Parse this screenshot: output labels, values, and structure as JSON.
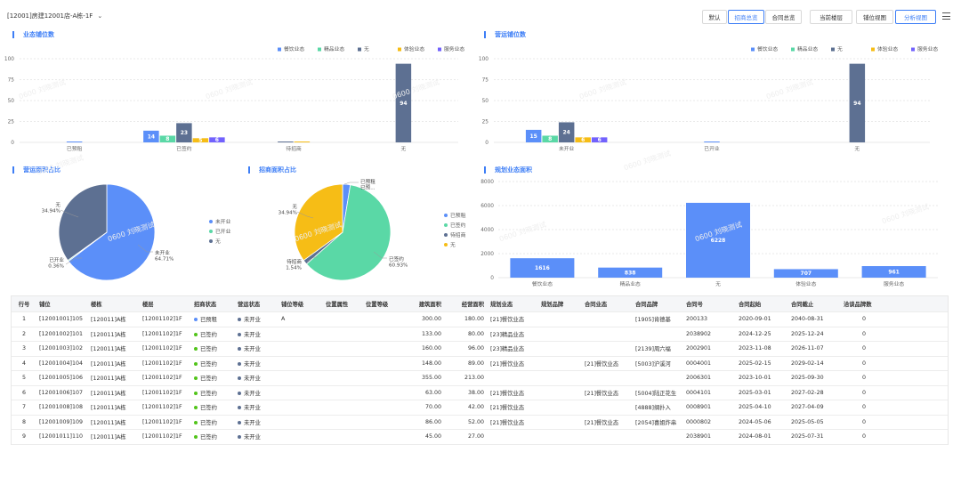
{
  "header": {
    "breadcrumb": "[12001]房建12001店-A栋-1F",
    "buttons": [
      "默认",
      "招商总览",
      "合同总览",
      "当前楼层",
      "铺位视图",
      "分析视图"
    ],
    "active_buttons": [
      1,
      5
    ]
  },
  "colors": {
    "accent": "#3d7ef6",
    "dining": "#5b8ff9",
    "boutique": "#5ad8a6",
    "none": "#5d7092",
    "experience": "#f6bd16",
    "service": "#7262fd"
  },
  "legend_biz": [
    "餐饮业态",
    "精品业态",
    "无",
    "体验业态",
    "服务业态"
  ],
  "watermark": "0600 刘晓测试",
  "panels": {
    "biz_slots": "业态铺位数",
    "op_slots": "营运铺位数",
    "op_area": "营运面积占比",
    "inv_area": "招商面积占比",
    "plan_area": "规划业态面积"
  },
  "chart_data": [
    {
      "type": "bar",
      "title": "业态铺位数",
      "categories": [
        "已预租",
        "已签约",
        "待招商",
        "无"
      ],
      "series": [
        {
          "name": "餐饮业态",
          "values": [
            1,
            14,
            0,
            0
          ]
        },
        {
          "name": "精品业态",
          "values": [
            0,
            8,
            0,
            0
          ]
        },
        {
          "name": "无",
          "values": [
            0,
            23,
            1,
            94
          ]
        },
        {
          "name": "体验业态",
          "values": [
            0,
            5,
            1,
            0
          ]
        },
        {
          "name": "服务业态",
          "values": [
            0,
            6,
            0,
            0
          ]
        }
      ],
      "data_labels": [
        "14",
        "8",
        "23",
        "5",
        "6",
        "94"
      ],
      "ylim": [
        0,
        100
      ],
      "yticks": [
        0,
        25,
        50,
        75,
        100
      ],
      "legend": "top-right"
    },
    {
      "type": "bar",
      "title": "营运铺位数",
      "categories": [
        "未开业",
        "已开业",
        "无"
      ],
      "series": [
        {
          "name": "餐饮业态",
          "values": [
            15,
            1,
            0
          ]
        },
        {
          "name": "精品业态",
          "values": [
            8,
            0,
            0
          ]
        },
        {
          "name": "无",
          "values": [
            24,
            0,
            94
          ]
        },
        {
          "name": "体验业态",
          "values": [
            6,
            0,
            0
          ]
        },
        {
          "name": "服务业态",
          "values": [
            6,
            0,
            0
          ]
        }
      ],
      "data_labels": [
        "15",
        "8",
        "24",
        "6",
        "6",
        "94"
      ],
      "ylim": [
        0,
        100
      ],
      "yticks": [
        0,
        25,
        50,
        75,
        100
      ],
      "legend": "top-right"
    },
    {
      "type": "pie",
      "title": "营运面积占比",
      "labels": [
        "未开业",
        "已开业",
        "无"
      ],
      "values": [
        64.71,
        0.36,
        34.94
      ],
      "pct_labels": [
        "64.71%",
        "0.36%",
        "34.94%"
      ],
      "colors": [
        "#5b8ff9",
        "#5ad8a6",
        "#5d7092"
      ]
    },
    {
      "type": "pie",
      "title": "招商面积占比",
      "labels": [
        "已预租",
        "已签约",
        "待招商",
        "无"
      ],
      "values": [
        2.6,
        60.93,
        1.54,
        34.94
      ],
      "pct_labels": [
        "已预...",
        "60.93%",
        "1.54%",
        "34.94%"
      ],
      "colors": [
        "#5b8ff9",
        "#5ad8a6",
        "#5d7092",
        "#f6bd16"
      ]
    },
    {
      "type": "bar",
      "title": "规划业态面积",
      "categories": [
        "餐饮业态",
        "精品业态",
        "无",
        "体验业态",
        "服务业态"
      ],
      "values": [
        1616,
        838,
        6228,
        707,
        961
      ],
      "ylim": [
        0,
        8000
      ],
      "yticks": [
        0,
        2000,
        4000,
        6000,
        8000
      ]
    }
  ],
  "table": {
    "columns": [
      "行号",
      "铺位",
      "楼栋",
      "楼层",
      "招商状态",
      "营运状态",
      "铺位等级",
      "位置属性",
      "位置等级",
      "建筑面积",
      "经营面积",
      "规划业态",
      "规划品牌",
      "合同业态",
      "合同品牌",
      "合同号",
      "合同起始",
      "合同截止",
      "洽谈品牌数"
    ],
    "rows": [
      [
        "1",
        "[12001001]105",
        "[120011]A栋",
        "[12001102]1F",
        "已预租",
        "未开业",
        "A",
        "",
        "",
        "300.00",
        "180.00",
        "[21]餐饮业态",
        "",
        "",
        "[1905]肯德基",
        "200133",
        "2020-09-01",
        "2040-08-31",
        "0"
      ],
      [
        "2",
        "[12001002]101",
        "[120011]A栋",
        "[12001102]1F",
        "已签约",
        "未开业",
        "",
        "",
        "",
        "133.00",
        "80.00",
        "[23]精品业态",
        "",
        "",
        "",
        "2038902",
        "2024-12-25",
        "2025-12-24",
        "0"
      ],
      [
        "3",
        "[12001003]102",
        "[120011]A栋",
        "[12001102]1F",
        "已签约",
        "未开业",
        "",
        "",
        "",
        "160.00",
        "96.00",
        "[23]精品业态",
        "",
        "",
        "[2139]周六福",
        "2002901",
        "2023-11-08",
        "2026-11-07",
        "0"
      ],
      [
        "4",
        "[12001004]104",
        "[120011]A栋",
        "[12001102]1F",
        "已签约",
        "未开业",
        "",
        "",
        "",
        "148.00",
        "89.00",
        "[21]餐饮业态",
        "",
        "[21]餐饮业态",
        "[5003]沪溪河",
        "0004001",
        "2025-02-15",
        "2029-02-14",
        "0"
      ],
      [
        "5",
        "[12001005]106",
        "[120011]A栋",
        "[12001102]1F",
        "已签约",
        "未开业",
        "",
        "",
        "",
        "355.00",
        "213.00",
        "",
        "",
        "",
        "",
        "2006301",
        "2023-10-01",
        "2025-09-30",
        "0"
      ],
      [
        "6",
        "[12001006]107",
        "[120011]A栋",
        "[12001102]1F",
        "已签约",
        "未开业",
        "",
        "",
        "",
        "63.00",
        "38.00",
        "[21]餐饮业态",
        "",
        "[21]餐饮业态",
        "[5004]陆正花生",
        "0004101",
        "2025-03-01",
        "2027-02-28",
        "0"
      ],
      [
        "7",
        "[12001008]108",
        "[120011]A栋",
        "[12001102]1F",
        "已签约",
        "未开业",
        "",
        "",
        "",
        "70.00",
        "42.00",
        "[21]餐饮业态",
        "",
        "",
        "[4888]绸扑入",
        "0008901",
        "2025-04-10",
        "2027-04-09",
        "0"
      ],
      [
        "8",
        "[12001009]109",
        "[120011]A栋",
        "[12001102]1F",
        "已签约",
        "未开业",
        "",
        "",
        "",
        "86.00",
        "52.00",
        "[21]餐饮业态",
        "",
        "[21]餐饮业态",
        "[2054]喜姐炸串",
        "0000802",
        "2024-05-06",
        "2025-05-05",
        "0"
      ],
      [
        "9",
        "[12001011]110",
        "[120011]A栋",
        "[12001102]1F",
        "已签约",
        "未开业",
        "",
        "",
        "",
        "45.00",
        "27.00",
        "",
        "",
        "",
        "",
        "2038901",
        "2024-08-01",
        "2025-07-31",
        "0"
      ]
    ]
  }
}
